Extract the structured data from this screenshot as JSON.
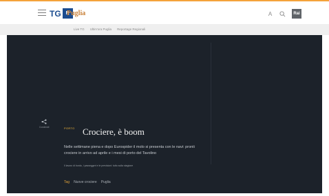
{
  "header": {
    "logo_tg": "TG",
    "logo_box": "R",
    "region": "Puglia",
    "rai_label": "Rai"
  },
  "subnav": {
    "items": [
      "Live TG",
      "Ultim'ora Puglia",
      "Reportage Regionali"
    ]
  },
  "hero": {
    "share_label": "Condividi",
    "kicker": "PORTO",
    "headline": "Crociere, è boom",
    "summary": "Nelle settimane piena e dopo Eurospider il molo si presenta con le navi: pronti crociere in arrivo ad aprile e i mesi di porto del Tavolino",
    "caption": "Il lavoro di bordo, i passeggeri e le previsioni: tutto sulla stagione"
  },
  "breadcrumbs": [
    "Tag",
    "Nuove crociere",
    "Puglia"
  ],
  "colors": {
    "accent": "#f5a33a",
    "brand": "#1b4c8f",
    "hero_bg": "#1c222a"
  }
}
